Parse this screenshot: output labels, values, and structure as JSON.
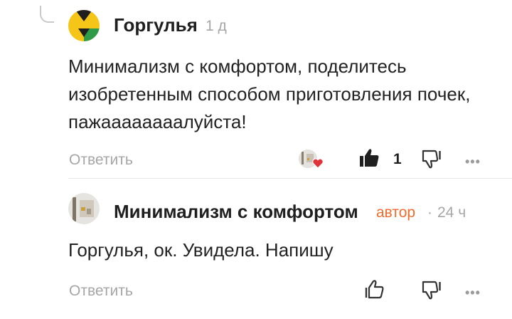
{
  "comments": [
    {
      "author": "Горгулья",
      "time": "1 д",
      "text": "Минимализм с комфортом, поделитесь изобретенным способом приготовления почек, пажаааааааалуйста!",
      "reply_label": "Ответить",
      "likes": "1",
      "more": "•••",
      "liked": true,
      "author_liked": true
    },
    {
      "author": "Минимализм с комфортом",
      "badge": "автор",
      "separator": "·",
      "time": "24 ч",
      "text": "Горгулья, ок. Увидела. Напишу",
      "reply_label": "Ответить",
      "more": "•••",
      "liked": false
    }
  ],
  "colors": {
    "author_badge": "#f26b2b",
    "heart": "#e0333a",
    "muted": "#a6a6a6",
    "avatar_yellow": "#f5c518",
    "avatar_green": "#2f9a48"
  },
  "icons": {
    "reply_thread": "reply-curve-icon",
    "like_filled": "thumbs-up-filled-icon",
    "like_outline": "thumbs-up-outline-icon",
    "dislike": "thumbs-down-outline-icon",
    "heart": "heart-icon",
    "more": "more-dots-icon"
  }
}
